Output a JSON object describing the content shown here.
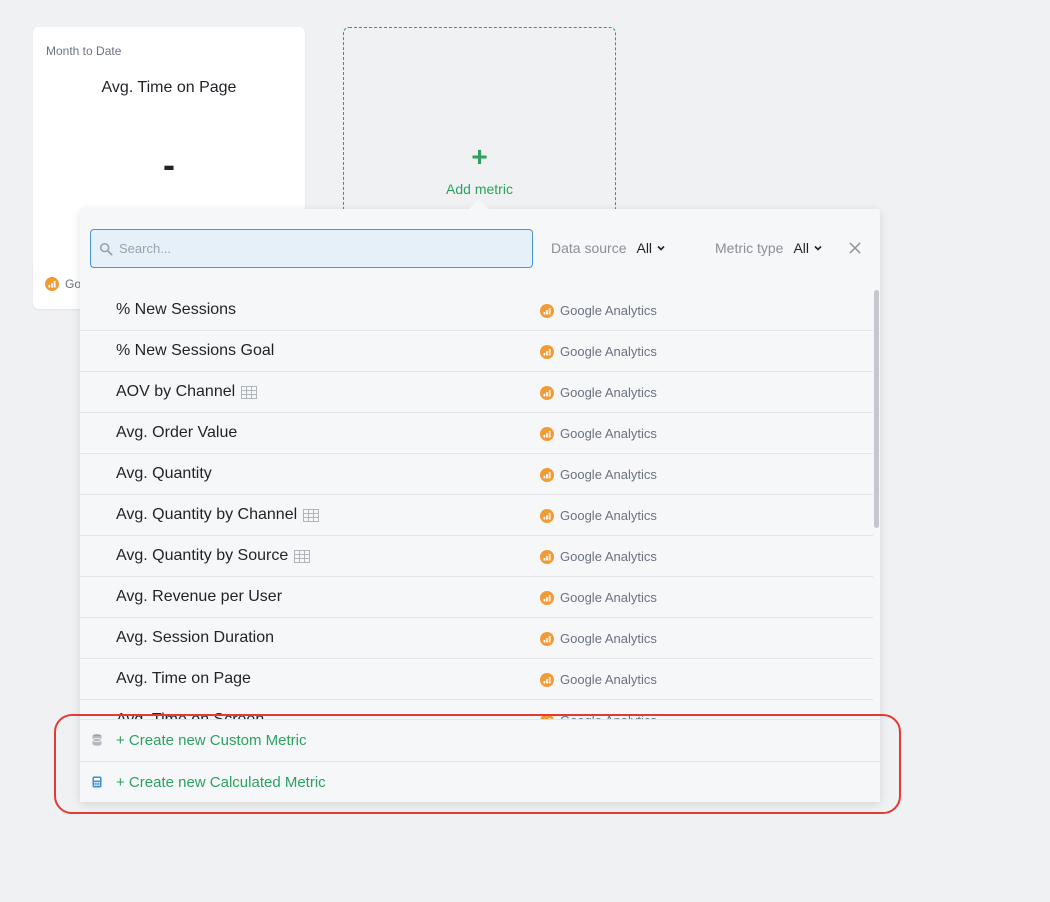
{
  "metric_card": {
    "period": "Month to Date",
    "title": "Avg. Time on Page",
    "value": "-",
    "source": "Go"
  },
  "add_card": {
    "plus": "+",
    "label": "Add metric"
  },
  "search": {
    "placeholder": "Search..."
  },
  "filters": {
    "data_source": {
      "label": "Data source",
      "value": "All"
    },
    "metric_type": {
      "label": "Metric type",
      "value": "All"
    }
  },
  "metrics": [
    {
      "name": "% New Sessions",
      "source": "Google Analytics",
      "table": false
    },
    {
      "name": "% New Sessions Goal",
      "source": "Google Analytics",
      "table": false
    },
    {
      "name": "AOV by Channel",
      "source": "Google Analytics",
      "table": true
    },
    {
      "name": "Avg. Order Value",
      "source": "Google Analytics",
      "table": false
    },
    {
      "name": "Avg. Quantity",
      "source": "Google Analytics",
      "table": false
    },
    {
      "name": "Avg. Quantity by Channel",
      "source": "Google Analytics",
      "table": true
    },
    {
      "name": "Avg. Quantity by Source",
      "source": "Google Analytics",
      "table": true
    },
    {
      "name": "Avg. Revenue per User",
      "source": "Google Analytics",
      "table": false
    },
    {
      "name": "Avg. Session Duration",
      "source": "Google Analytics",
      "table": false
    },
    {
      "name": "Avg. Time on Page",
      "source": "Google Analytics",
      "table": false
    },
    {
      "name": "Avg. Time on Screen",
      "source": "Google Analytics",
      "table": false
    }
  ],
  "footer": {
    "custom": "+ Create new Custom Metric",
    "calculated": "+ Create new Calculated Metric"
  },
  "colors": {
    "accent": "#2da160",
    "ga_orange": "#f29a36",
    "highlight": "#e53935",
    "search_border": "#4a95d9"
  },
  "icons": {
    "search": "search-icon",
    "chevron": "chevron-down-icon",
    "close": "close-icon",
    "ga": "google-analytics-icon",
    "table": "table-icon",
    "database": "database-icon",
    "calculator": "calculator-icon"
  }
}
